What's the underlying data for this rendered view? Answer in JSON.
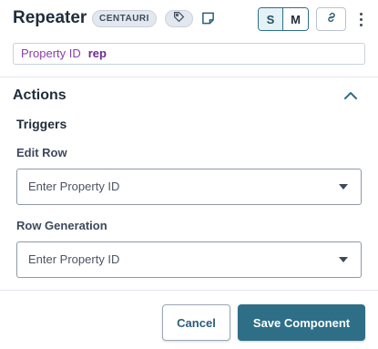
{
  "header": {
    "title": "Repeater",
    "badge": "CENTAURI",
    "tag_icon": "tag-icon",
    "note_icon": "note-icon",
    "size_options": [
      "S",
      "M"
    ],
    "size_selected": "S",
    "link_icon": "link-icon",
    "menu_icon": "kebab-menu-icon"
  },
  "property": {
    "label": "Property ID",
    "value": "rep"
  },
  "actions": {
    "title": "Actions",
    "collapse_icon": "chevron-up-icon",
    "triggers_title": "Triggers",
    "edit_row": {
      "label": "Edit Row",
      "placeholder": "Enter Property ID"
    },
    "row_generation": {
      "label": "Row Generation",
      "placeholder": "Enter Property ID"
    }
  },
  "footer": {
    "cancel_label": "Cancel",
    "save_label": "Save Component"
  },
  "colors": {
    "accent": "#2e6f87",
    "property_text": "#8a3ea8"
  }
}
